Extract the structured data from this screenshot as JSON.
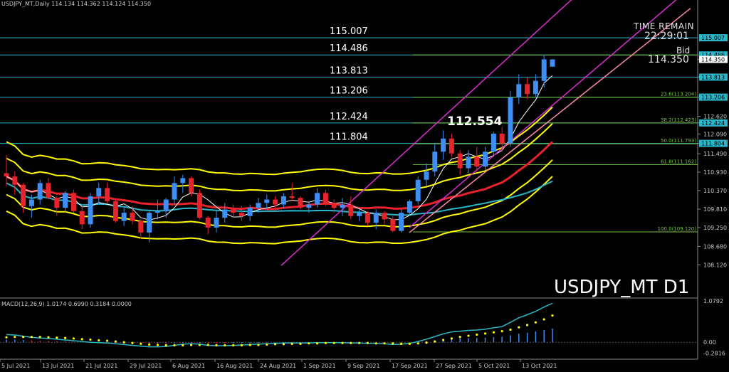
{
  "header": {
    "info": "USDJPY_MT,Daily  114.134 114.362 114.124 114.350"
  },
  "time_remain": {
    "label": "TIME REMAIN",
    "value": "22:29:01"
  },
  "bid": {
    "label": "Bid",
    "value": "114.350"
  },
  "watermark": "USDJPY_MT D1",
  "macd_header": "MACD(12,26,9) 1.0174 0.6990 0.3184 0.0000",
  "big_label": "112.554",
  "colors": {
    "bull": "#3d8ef5",
    "bear": "#e8232c",
    "level": "#2ab5c9",
    "bollinger": "#ffff00",
    "channel": "#d92ed0",
    "ma_red": "#e8232c",
    "ma_teal": "#29b6c9",
    "fib": "#76c440"
  },
  "chart_data": [
    {
      "type": "candlestick",
      "price_axis": {
        "min": 107.2,
        "max": 115.85,
        "ticks": [
          "114.486",
          "114.350",
          "113.813",
          "113.206",
          "112.620",
          "112.424",
          "112.090",
          "111.804",
          "111.490",
          "110.930",
          "110.370",
          "109.810",
          "109.250",
          "108.680",
          "108.120"
        ]
      },
      "date_axis": {
        "ticks": [
          "5 Jul 2021",
          "13 Jul 2021",
          "21 Jul 2021",
          "29 Jul 2021",
          "6 Aug 2021",
          "16 Aug 2021",
          "24 Aug 2021",
          "1 Sep 2021",
          "9 Sep 2021",
          "17 Sep 2021",
          "27 Sep 2021",
          "5 Oct 2021",
          "13 Oct 2021"
        ]
      },
      "levels": [
        {
          "value": 115.007,
          "label": "115.007",
          "tag": "115.007"
        },
        {
          "value": 114.486,
          "label": "114.486",
          "tag": "114.486"
        },
        {
          "value": 113.813,
          "label": "113.813",
          "tag": "113.813"
        },
        {
          "value": 113.206,
          "label": "113.206",
          "tag": "113.206"
        },
        {
          "value": 112.424,
          "label": "112.424",
          "tag": "112.424"
        },
        {
          "value": 111.804,
          "label": "111.804",
          "tag": "111.804"
        }
      ],
      "fib_levels": [
        {
          "value": 114.486,
          "label": ""
        },
        {
          "value": 113.204,
          "label": "23.6(113.204)"
        },
        {
          "value": 112.423,
          "label": "38.2(112.423)"
        },
        {
          "value": 111.793,
          "label": "50.0(111.793)"
        },
        {
          "value": 111.162,
          "label": "61.8(111.162)"
        },
        {
          "value": 109.12,
          "label": "100.0(109.120)"
        }
      ],
      "current_price": 114.35,
      "candles": [
        {
          "o": 110.9,
          "h": 111.45,
          "l": 110.5,
          "c": 110.8
        },
        {
          "o": 110.8,
          "h": 110.95,
          "l": 110.25,
          "c": 110.55
        },
        {
          "o": 110.55,
          "h": 110.6,
          "l": 109.7,
          "c": 109.9
        },
        {
          "o": 109.9,
          "h": 110.25,
          "l": 109.55,
          "c": 110.1
        },
        {
          "o": 110.1,
          "h": 110.7,
          "l": 109.95,
          "c": 110.6
        },
        {
          "o": 110.6,
          "h": 110.75,
          "l": 110.1,
          "c": 110.15
        },
        {
          "o": 110.15,
          "h": 110.2,
          "l": 109.6,
          "c": 109.85
        },
        {
          "o": 109.85,
          "h": 110.35,
          "l": 109.7,
          "c": 110.3
        },
        {
          "o": 110.3,
          "h": 110.4,
          "l": 109.7,
          "c": 109.75
        },
        {
          "o": 109.75,
          "h": 109.9,
          "l": 109.2,
          "c": 109.35
        },
        {
          "o": 109.35,
          "h": 110.3,
          "l": 109.25,
          "c": 110.2
        },
        {
          "o": 110.2,
          "h": 110.6,
          "l": 109.95,
          "c": 110.45
        },
        {
          "o": 110.45,
          "h": 110.6,
          "l": 110.0,
          "c": 110.05
        },
        {
          "o": 110.05,
          "h": 110.1,
          "l": 109.4,
          "c": 109.45
        },
        {
          "o": 109.45,
          "h": 109.85,
          "l": 109.3,
          "c": 109.7
        },
        {
          "o": 109.7,
          "h": 109.9,
          "l": 109.35,
          "c": 109.45
        },
        {
          "o": 109.45,
          "h": 109.5,
          "l": 108.9,
          "c": 109.1
        },
        {
          "o": 109.1,
          "h": 109.8,
          "l": 108.8,
          "c": 109.7
        },
        {
          "o": 109.7,
          "h": 110.1,
          "l": 109.5,
          "c": 109.75
        },
        {
          "o": 109.75,
          "h": 110.15,
          "l": 109.55,
          "c": 110.1
        },
        {
          "o": 110.1,
          "h": 110.8,
          "l": 109.95,
          "c": 110.6
        },
        {
          "o": 110.6,
          "h": 110.85,
          "l": 110.3,
          "c": 110.75
        },
        {
          "o": 110.75,
          "h": 110.8,
          "l": 110.2,
          "c": 110.3
        },
        {
          "o": 110.3,
          "h": 110.4,
          "l": 109.5,
          "c": 109.55
        },
        {
          "o": 109.55,
          "h": 109.6,
          "l": 109.05,
          "c": 109.25
        },
        {
          "o": 109.25,
          "h": 109.75,
          "l": 109.1,
          "c": 109.55
        },
        {
          "o": 109.55,
          "h": 110.0,
          "l": 109.4,
          "c": 109.8
        },
        {
          "o": 109.8,
          "h": 109.95,
          "l": 109.55,
          "c": 109.7
        },
        {
          "o": 109.7,
          "h": 109.9,
          "l": 109.45,
          "c": 109.6
        },
        {
          "o": 109.6,
          "h": 109.95,
          "l": 109.45,
          "c": 109.85
        },
        {
          "o": 109.85,
          "h": 110.15,
          "l": 109.7,
          "c": 110.0
        },
        {
          "o": 110.0,
          "h": 110.25,
          "l": 109.8,
          "c": 110.1
        },
        {
          "o": 110.1,
          "h": 110.2,
          "l": 109.85,
          "c": 109.95
        },
        {
          "o": 109.95,
          "h": 110.3,
          "l": 109.85,
          "c": 110.2
        },
        {
          "o": 110.2,
          "h": 110.6,
          "l": 110.05,
          "c": 110.15
        },
        {
          "o": 110.15,
          "h": 110.2,
          "l": 109.8,
          "c": 109.85
        },
        {
          "o": 109.85,
          "h": 110.05,
          "l": 109.7,
          "c": 109.95
        },
        {
          "o": 109.95,
          "h": 110.45,
          "l": 109.85,
          "c": 110.3
        },
        {
          "o": 110.3,
          "h": 110.4,
          "l": 109.9,
          "c": 110.0
        },
        {
          "o": 110.0,
          "h": 110.1,
          "l": 109.7,
          "c": 109.85
        },
        {
          "o": 109.85,
          "h": 110.15,
          "l": 109.6,
          "c": 109.95
        },
        {
          "o": 109.95,
          "h": 110.2,
          "l": 109.5,
          "c": 109.6
        },
        {
          "o": 109.6,
          "h": 109.8,
          "l": 109.45,
          "c": 109.7
        },
        {
          "o": 109.7,
          "h": 109.75,
          "l": 109.3,
          "c": 109.4
        },
        {
          "o": 109.4,
          "h": 109.8,
          "l": 109.2,
          "c": 109.7
        },
        {
          "o": 109.7,
          "h": 109.75,
          "l": 109.35,
          "c": 109.5
        },
        {
          "o": 109.5,
          "h": 109.6,
          "l": 109.1,
          "c": 109.15
        },
        {
          "o": 109.15,
          "h": 109.8,
          "l": 109.1,
          "c": 109.7
        },
        {
          "o": 109.7,
          "h": 110.1,
          "l": 109.6,
          "c": 110.05
        },
        {
          "o": 110.05,
          "h": 110.8,
          "l": 109.95,
          "c": 110.7
        },
        {
          "o": 110.7,
          "h": 111.2,
          "l": 110.5,
          "c": 110.95
        },
        {
          "o": 110.95,
          "h": 111.8,
          "l": 110.8,
          "c": 111.55
        },
        {
          "o": 111.55,
          "h": 112.2,
          "l": 111.3,
          "c": 111.95
        },
        {
          "o": 111.95,
          "h": 112.1,
          "l": 111.4,
          "c": 111.5
        },
        {
          "o": 111.5,
          "h": 111.6,
          "l": 110.85,
          "c": 111.05
        },
        {
          "o": 111.05,
          "h": 111.6,
          "l": 110.9,
          "c": 111.4
        },
        {
          "o": 111.4,
          "h": 111.7,
          "l": 110.95,
          "c": 111.1
        },
        {
          "o": 111.1,
          "h": 111.7,
          "l": 111.0,
          "c": 111.55
        },
        {
          "o": 111.55,
          "h": 112.15,
          "l": 111.4,
          "c": 112.1
        },
        {
          "o": 112.1,
          "h": 112.3,
          "l": 111.55,
          "c": 111.8
        },
        {
          "o": 111.8,
          "h": 113.4,
          "l": 111.7,
          "c": 113.2
        },
        {
          "o": 113.2,
          "h": 113.9,
          "l": 113.0,
          "c": 113.6
        },
        {
          "o": 113.6,
          "h": 113.8,
          "l": 113.15,
          "c": 113.3
        },
        {
          "o": 113.3,
          "h": 113.9,
          "l": 113.2,
          "c": 113.7
        },
        {
          "o": 113.7,
          "h": 114.5,
          "l": 113.5,
          "c": 114.35
        },
        {
          "o": 114.13,
          "h": 114.36,
          "l": 114.12,
          "c": 114.35
        }
      ]
    },
    {
      "type": "macd",
      "params": "MACD(12,26,9)",
      "values": {
        "macd": 1.0174,
        "signal": 0.699,
        "histogram": 0.3184
      },
      "axis": {
        "min": -0.35,
        "max": 1.12,
        "ticks": [
          "1.0792",
          "0.00",
          "-0.2816"
        ]
      },
      "macd_line": [
        0.2,
        0.19,
        0.16,
        0.13,
        0.11,
        0.1,
        0.08,
        0.06,
        0.04,
        0.02,
        0.0,
        -0.01,
        -0.02,
        -0.04,
        -0.06,
        -0.08,
        -0.1,
        -0.12,
        -0.12,
        -0.11,
        -0.08,
        -0.05,
        -0.04,
        -0.05,
        -0.08,
        -0.09,
        -0.09,
        -0.08,
        -0.07,
        -0.06,
        -0.05,
        -0.04,
        -0.03,
        -0.02,
        -0.02,
        -0.02,
        -0.02,
        -0.01,
        -0.01,
        -0.01,
        -0.01,
        -0.02,
        -0.02,
        -0.03,
        -0.03,
        -0.04,
        -0.06,
        -0.05,
        -0.03,
        0.02,
        0.08,
        0.15,
        0.22,
        0.27,
        0.29,
        0.31,
        0.32,
        0.34,
        0.38,
        0.41,
        0.52,
        0.64,
        0.72,
        0.81,
        0.92,
        1.02
      ],
      "signal_line": [
        0.13,
        0.14,
        0.14,
        0.14,
        0.14,
        0.13,
        0.12,
        0.11,
        0.1,
        0.08,
        0.07,
        0.05,
        0.04,
        0.02,
        0.0,
        -0.02,
        -0.04,
        -0.06,
        -0.07,
        -0.08,
        -0.08,
        -0.08,
        -0.07,
        -0.07,
        -0.07,
        -0.08,
        -0.08,
        -0.08,
        -0.08,
        -0.07,
        -0.07,
        -0.06,
        -0.05,
        -0.05,
        -0.04,
        -0.04,
        -0.03,
        -0.03,
        -0.02,
        -0.02,
        -0.02,
        -0.02,
        -0.02,
        -0.02,
        -0.03,
        -0.03,
        -0.03,
        -0.04,
        -0.04,
        -0.03,
        -0.01,
        0.02,
        0.06,
        0.1,
        0.14,
        0.17,
        0.2,
        0.23,
        0.26,
        0.29,
        0.33,
        0.39,
        0.45,
        0.52,
        0.6,
        0.7
      ]
    }
  ]
}
